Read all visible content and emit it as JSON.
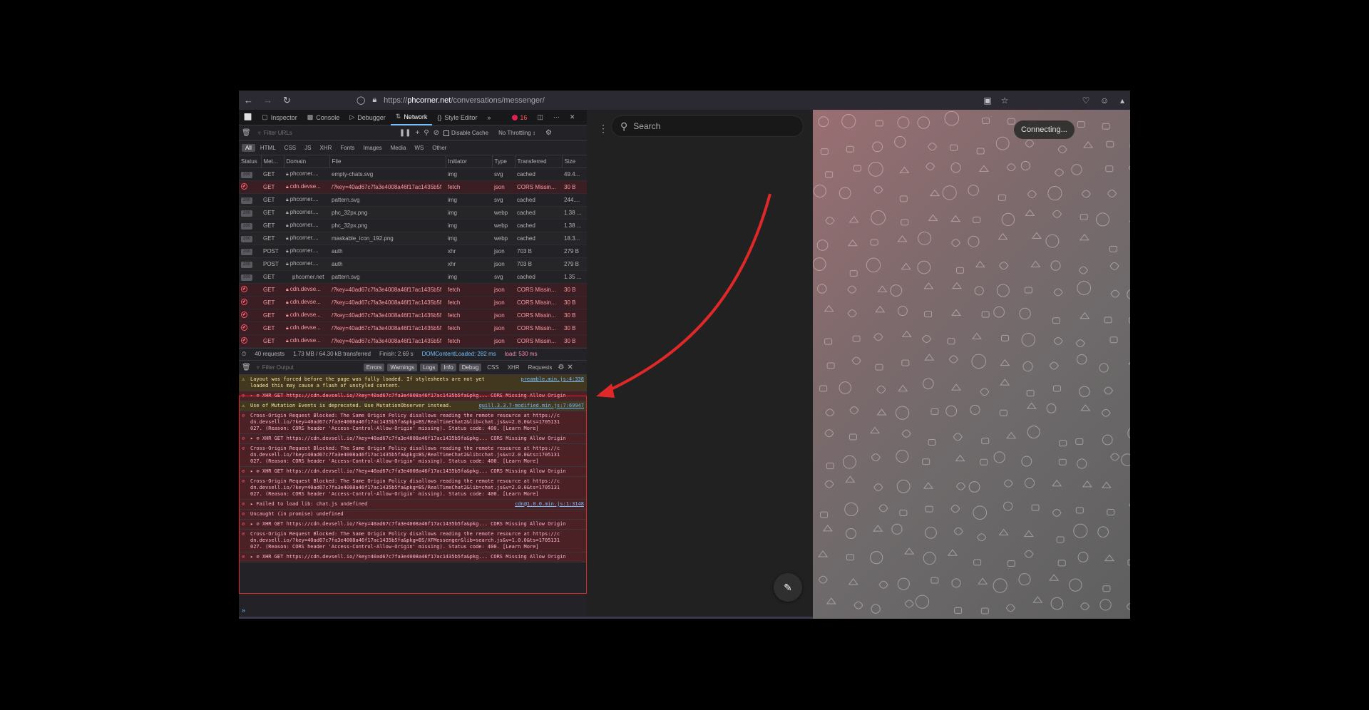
{
  "browser": {
    "url_prefix": "https://",
    "url_host": "phcorner.net",
    "url_path": "/conversations/messenger/"
  },
  "devtools": {
    "tabs": [
      {
        "label": "Inspector"
      },
      {
        "label": "Console"
      },
      {
        "label": "Debugger"
      },
      {
        "label": "Network"
      },
      {
        "label": "Style Editor"
      }
    ],
    "error_count": "16",
    "filter_urls_placeholder": "Filter URLs",
    "disable_cache_label": "Disable Cache",
    "throttling_label": "No Throttling ↕",
    "type_filters": [
      "All",
      "HTML",
      "CSS",
      "JS",
      "XHR",
      "Fonts",
      "Images",
      "Media",
      "WS",
      "Other"
    ],
    "columns": [
      "Status",
      "Met...",
      "Domain",
      "File",
      "Initiator",
      "Type",
      "Transferred",
      "Size"
    ],
    "rows": [
      {
        "status": "200",
        "method": "GET",
        "domain": "phcorner....",
        "file": "empty-chats.svg",
        "initiator": "img",
        "type": "svg",
        "transferred": "cached",
        "size": "49.4..."
      },
      {
        "status": "blocked",
        "method": "GET",
        "domain": "cdn.devse...",
        "file": "/?key=40ad67c7fa3e4008a46f17ac1435b5f",
        "initiator": "fetch",
        "type": "json",
        "transferred": "CORS Missin...",
        "size": "30 B"
      },
      {
        "status": "200",
        "method": "GET",
        "domain": "phcorner....",
        "file": "pattern.svg",
        "initiator": "img",
        "type": "svg",
        "transferred": "cached",
        "size": "244...."
      },
      {
        "status": "200",
        "method": "GET",
        "domain": "phcorner....",
        "file": "phc_32px.png",
        "initiator": "img",
        "type": "webp",
        "transferred": "cached",
        "size": "1.38 ..."
      },
      {
        "status": "200",
        "method": "GET",
        "domain": "phcorner....",
        "file": "phc_32px.png",
        "initiator": "img",
        "type": "webp",
        "transferred": "cached",
        "size": "1.38 ..."
      },
      {
        "status": "200",
        "method": "GET",
        "domain": "phcorner....",
        "file": "maskable_icon_192.png",
        "initiator": "img",
        "type": "webp",
        "transferred": "cached",
        "size": "18.3..."
      },
      {
        "status": "200",
        "method": "POST",
        "domain": "phcorner....",
        "file": "auth",
        "initiator": "xhr",
        "type": "json",
        "transferred": "703 B",
        "size": "279 B"
      },
      {
        "status": "200",
        "method": "POST",
        "domain": "phcorner....",
        "file": "auth",
        "initiator": "xhr",
        "type": "json",
        "transferred": "703 B",
        "size": "279 B"
      },
      {
        "status": "200",
        "method": "GET",
        "domain": "phcorner.net",
        "file": "pattern.svg",
        "initiator": "img",
        "type": "svg",
        "transferred": "cached",
        "size": "1.35 ..."
      },
      {
        "status": "blocked",
        "method": "GET",
        "domain": "cdn.devse...",
        "file": "/?key=40ad67c7fa3e4008a46f17ac1435b5f",
        "initiator": "fetch",
        "type": "json",
        "transferred": "CORS Missin...",
        "size": "30 B"
      },
      {
        "status": "blocked",
        "method": "GET",
        "domain": "cdn.devse...",
        "file": "/?key=40ad67c7fa3e4008a46f17ac1435b5f",
        "initiator": "fetch",
        "type": "json",
        "transferred": "CORS Missin...",
        "size": "30 B"
      },
      {
        "status": "blocked",
        "method": "GET",
        "domain": "cdn.devse...",
        "file": "/?key=40ad67c7fa3e4008a46f17ac1435b5f",
        "initiator": "fetch",
        "type": "json",
        "transferred": "CORS Missin...",
        "size": "30 B"
      },
      {
        "status": "blocked",
        "method": "GET",
        "domain": "cdn.devse...",
        "file": "/?key=40ad67c7fa3e4008a46f17ac1435b5f",
        "initiator": "fetch",
        "type": "json",
        "transferred": "CORS Missin...",
        "size": "30 B"
      },
      {
        "status": "blocked",
        "method": "GET",
        "domain": "cdn.devse...",
        "file": "/?key=40ad67c7fa3e4008a46f17ac1435b5f",
        "initiator": "fetch",
        "type": "json",
        "transferred": "CORS Missin...",
        "size": "30 B"
      }
    ],
    "summary": {
      "requests": "40 requests",
      "transferred": "1.73 MB / 64.30 kB transferred",
      "finish": "Finish: 2.69 s",
      "dom_loaded": "DOMContentLoaded: 282 ms",
      "load": "load: 530 ms"
    },
    "console_filter_placeholder": "Filter Output",
    "console_levels": [
      "Errors",
      "Warnings",
      "Logs",
      "Info",
      "Debug"
    ],
    "console_extra": [
      "CSS",
      "XHR",
      "Requests"
    ],
    "logs": [
      {
        "kind": "warn",
        "lines": [
          "Layout was forced before the page was fully loaded. If stylesheets are not yet",
          "loaded this may cause a flash of unstyled content."
        ],
        "src": "preamble.min.js:4:338"
      },
      {
        "kind": "err",
        "lines": [
          "▸ ⊘ XHR GET https://cdn.devsell.io/?key=40ad67c7fa3e4008a46f17ac1435b5fa&pkg... CORS Missing Allow Origin"
        ],
        "src": ""
      },
      {
        "kind": "warn",
        "lines": [
          "Use of Mutation Events is deprecated. Use MutationObserver instead."
        ],
        "src": "quill.3.3.7-modified.min.js:7:69947"
      },
      {
        "kind": "err",
        "lines": [
          "Cross-Origin Request Blocked: The Same Origin Policy disallows reading the remote resource at https://c",
          "dn.devsell.io/?key=40ad67c7fa3e4008a46f17ac1435b5fa&pkg=BS/RealTimeChat2&lib=chat.js&v=2.0.0&ts=1705131",
          "027. (Reason: CORS header 'Access-Control-Allow-Origin' missing). Status code: 400. [Learn More]"
        ],
        "src": ""
      },
      {
        "kind": "err",
        "lines": [
          "▸ ⊘ XHR GET https://cdn.devsell.io/?key=40ad67c7fa3e4008a46f17ac1435b5fa&pkg... CORS Missing Allow Origin"
        ],
        "src": ""
      },
      {
        "kind": "err",
        "lines": [
          "Cross-Origin Request Blocked: The Same Origin Policy disallows reading the remote resource at https://c",
          "dn.devsell.io/?key=40ad67c7fa3e4008a46f17ac1435b5fa&pkg=BS/RealTimeChat2&lib=chat.js&v=2.0.0&ts=1705131",
          "027. (Reason: CORS header 'Access-Control-Allow-Origin' missing). Status code: 400. [Learn More]"
        ],
        "src": ""
      },
      {
        "kind": "err",
        "lines": [
          "▸ ⊘ XHR GET https://cdn.devsell.io/?key=40ad67c7fa3e4008a46f17ac1435b5fa&pkg... CORS Missing Allow Origin"
        ],
        "src": ""
      },
      {
        "kind": "err",
        "lines": [
          "Cross-Origin Request Blocked: The Same Origin Policy disallows reading the remote resource at https://c",
          "dn.devsell.io/?key=40ad67c7fa3e4008a46f17ac1435b5fa&pkg=BS/RealTimeChat2&lib=chat.js&v=2.0.0&ts=1705131",
          "027. (Reason: CORS header 'Access-Control-Allow-Origin' missing). Status code: 400. [Learn More]"
        ],
        "src": ""
      },
      {
        "kind": "err",
        "lines": [
          "▸ Failed to load lib: chat.js undefined"
        ],
        "src": "cdn@1.0.0.min.js:1:3148"
      },
      {
        "kind": "err",
        "lines": [
          "Uncaught (in promise) undefined"
        ],
        "src": ""
      },
      {
        "kind": "err",
        "lines": [
          "▸ ⊘ XHR GET https://cdn.devsell.io/?key=40ad67c7fa3e4008a46f17ac1435b5fa&pkg... CORS Missing Allow Origin"
        ],
        "src": ""
      },
      {
        "kind": "err",
        "lines": [
          "Cross-Origin Request Blocked: The Same Origin Policy disallows reading the remote resource at https://c",
          "dn.devsell.io/?key=40ad67c7fa3e4008a46f17ac1435b5fa&pkg=BS/XFMessenger&lib=search.js&v=1.0.0&ts=1705131",
          "027. (Reason: CORS header 'Access-Control-Allow-Origin' missing). Status code: 400. [Learn More]"
        ],
        "src": ""
      },
      {
        "kind": "err",
        "lines": [
          "▸ ⊘ XHR GET https://cdn.devsell.io/?key=40ad67c7fa3e4008a46f17ac1435b5fa&pkg... CORS Missing Allow Origin"
        ],
        "src": ""
      }
    ]
  },
  "messenger": {
    "search_placeholder": "Search",
    "connecting_label": "Connecting..."
  },
  "annotation_color": "#e02828"
}
